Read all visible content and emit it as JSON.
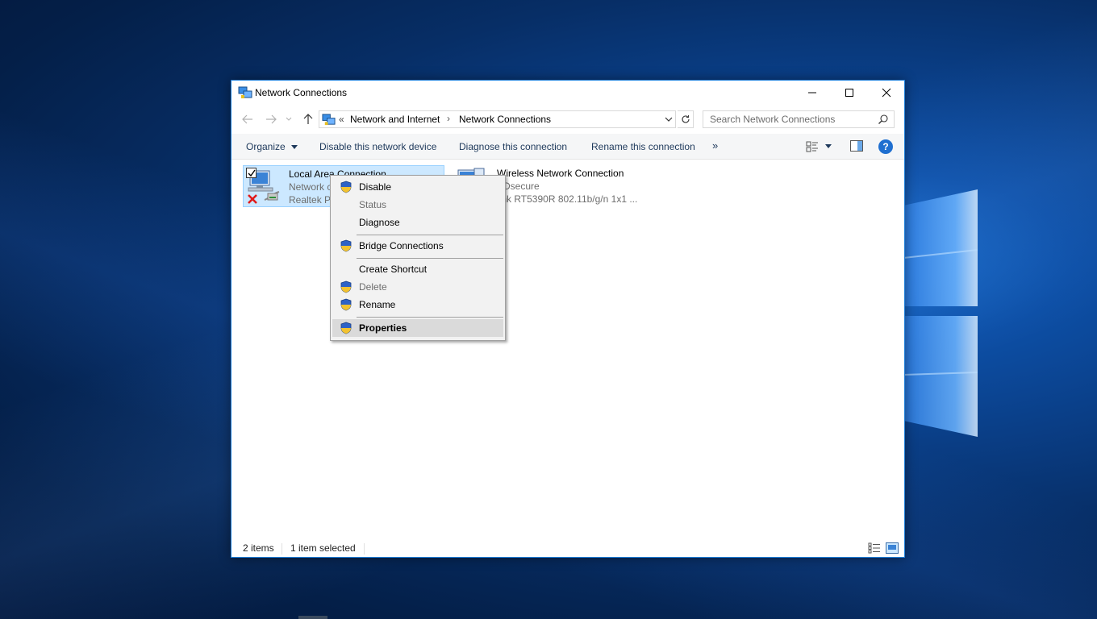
{
  "window": {
    "title": "Network Connections"
  },
  "address_bar": {
    "overflow": "«",
    "crumbs": [
      "Network and Internet",
      "Network Connections"
    ],
    "separator": "›"
  },
  "search": {
    "placeholder": "Search Network Connections"
  },
  "command_bar": {
    "organize": "Organize",
    "disable": "Disable this network device",
    "diagnose": "Diagnose this connection",
    "rename": "Rename this connection",
    "more": "»",
    "help": "?"
  },
  "items": [
    {
      "name": "Local Area Connection",
      "line2": "Network c",
      "line3": "Realtek PC",
      "selected": true,
      "checked": true,
      "status": "disconnected"
    },
    {
      "name": "Wireless Network Connection",
      "line2": "EDsecure",
      "line3": "link RT5390R 802.11b/g/n 1x1 ...",
      "selected": false
    }
  ],
  "status_bar": {
    "count": "2 items",
    "selection": "1 item selected"
  },
  "context_menu": {
    "items": [
      {
        "label": "Disable",
        "shield": true,
        "enabled": true
      },
      {
        "label": "Status",
        "shield": false,
        "enabled": false
      },
      {
        "label": "Diagnose",
        "shield": false,
        "enabled": true
      },
      {
        "label": "Bridge Connections",
        "shield": true,
        "enabled": true
      },
      {
        "label": "Create Shortcut",
        "shield": false,
        "enabled": true
      },
      {
        "label": "Delete",
        "shield": true,
        "enabled": false
      },
      {
        "label": "Rename",
        "shield": true,
        "enabled": true
      },
      {
        "label": "Properties",
        "shield": true,
        "enabled": true,
        "default": true,
        "highlighted": true
      }
    ]
  },
  "colors": {
    "accent": "#1f7fd8",
    "selection": "#cce8ff",
    "command_text": "#1e395b",
    "disabled_text": "#6d6d6d"
  }
}
